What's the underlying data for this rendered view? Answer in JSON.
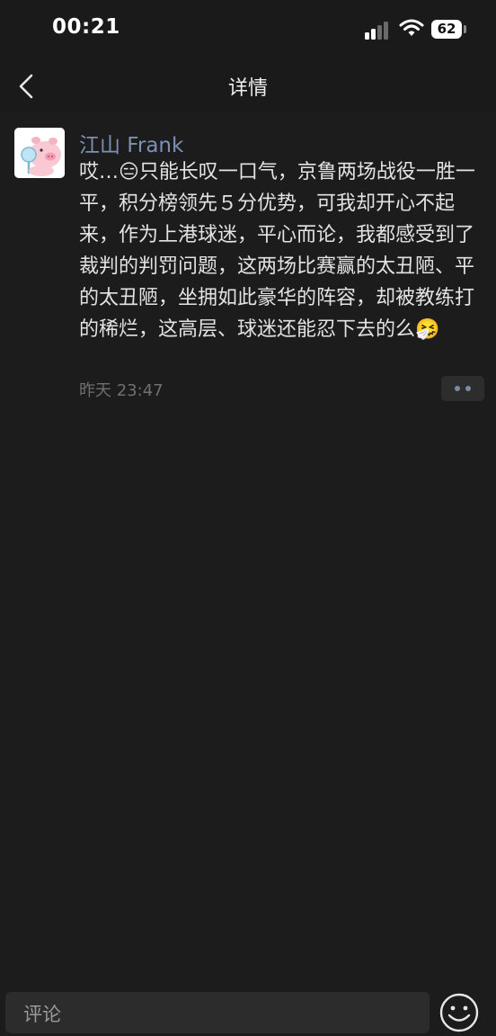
{
  "status_bar": {
    "time": "00:21",
    "battery": "62"
  },
  "nav": {
    "title": "详情",
    "back_icon": "chevron-left-icon"
  },
  "post": {
    "author": "江山 Frank",
    "avatar_icon": "pink-pig-avatar",
    "content": "哎…😑只能长叹一口气，京鲁两场战役一胜一平，积分榜领先５分优势，可我却开心不起来，作为上港球迷，平心而论，我都感受到了裁判的判罚问题，这两场比赛赢的太丑陋、平的太丑陋，坐拥如此豪华的阵容，却被教练打的稀烂，这高层、球迷还能忍下去的么🤧",
    "time": "昨天 23:47",
    "more_icon": "more-dots-icon"
  },
  "comment_bar": {
    "placeholder": "评论",
    "emoji_icon": "smiley-icon"
  },
  "colors": {
    "background": "#1c1c1c",
    "bar_background": "#1a1a1a",
    "author_link": "#7d90b6",
    "text": "#e3e3e3",
    "muted": "#6f6f6f"
  }
}
